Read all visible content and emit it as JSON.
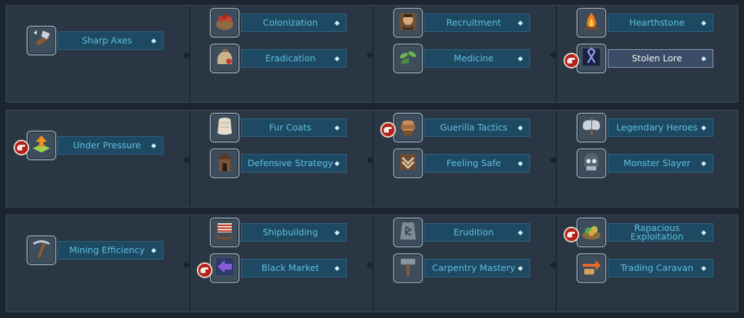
{
  "colors": {
    "background": "#1b2530",
    "panel": "#2a3643",
    "bar": "#1d4963",
    "label": "#5fc0de",
    "selected_bar": "#3a4c66",
    "badge": "#b3221c"
  },
  "rows": [
    {
      "columns": [
        [
          {
            "label": "Sharp Axes",
            "icon": "axe-icon",
            "badge": false
          }
        ],
        [
          {
            "label": "Colonization",
            "icon": "supply-basket-icon",
            "badge": false
          },
          {
            "label": "Eradication",
            "icon": "provisions-sack-icon",
            "badge": false
          }
        ],
        [
          {
            "label": "Recruitment",
            "icon": "soldier-portrait-icon",
            "badge": false
          },
          {
            "label": "Medicine",
            "icon": "herb-leaf-icon",
            "badge": false
          }
        ],
        [
          {
            "label": "Hearthstone",
            "icon": "campfire-icon",
            "badge": false
          },
          {
            "label": "Stolen Lore",
            "icon": "rune-icon",
            "badge": true,
            "selected": true
          }
        ]
      ]
    },
    {
      "columns": [
        [
          {
            "label": "Under Pressure",
            "icon": "arrow-up-tile-icon",
            "badge": true
          }
        ],
        [
          {
            "label": "Fur Coats",
            "icon": "fur-pelt-icon",
            "badge": false
          },
          {
            "label": "Defensive Strategy",
            "icon": "watchtower-icon",
            "badge": false
          }
        ],
        [
          {
            "label": "Guerilla Tactics",
            "icon": "fist-icon",
            "badge": true
          },
          {
            "label": "Feeling Safe",
            "icon": "chevron-shield-icon",
            "badge": false
          }
        ],
        [
          {
            "label": "Legendary Heroes",
            "icon": "double-axe-icon",
            "badge": false
          },
          {
            "label": "Monster Slayer",
            "icon": "skull-helmet-icon",
            "badge": false
          }
        ]
      ]
    },
    {
      "columns": [
        [
          {
            "label": "Mining Efficiency",
            "icon": "pickaxe-icon",
            "badge": false
          }
        ],
        [
          {
            "label": "Shipbuilding",
            "icon": "longship-icon",
            "badge": false
          },
          {
            "label": "Black Market",
            "icon": "arrow-left-icon",
            "badge": true
          }
        ],
        [
          {
            "label": "Erudition",
            "icon": "rune-stone-icon",
            "badge": false
          },
          {
            "label": "Carpentry Mastery",
            "icon": "hammer-icon",
            "badge": false
          }
        ],
        [
          {
            "label": "Rapacious Exploitation",
            "icon": "loot-pile-icon",
            "badge": true
          },
          {
            "label": "Trading Caravan",
            "icon": "trade-exchange-icon",
            "badge": false
          }
        ]
      ]
    }
  ]
}
